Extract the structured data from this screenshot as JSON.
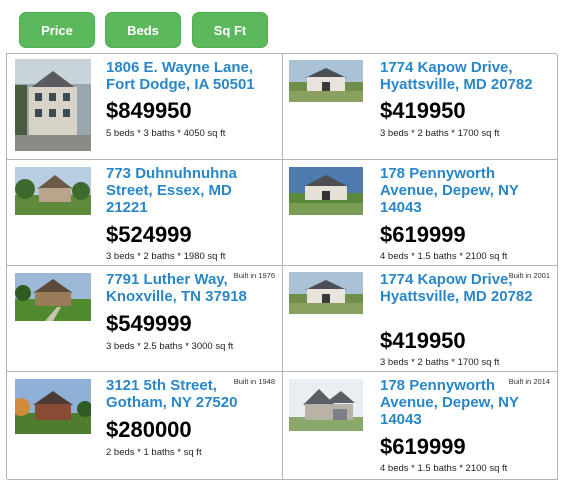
{
  "sort_buttons": [
    "Price",
    "Beds",
    "Sq Ft"
  ],
  "listings": [
    {
      "address": "1806 E. Wayne Lane, Fort Dodge, IA 50501",
      "price": "$849950",
      "details": "5 beds * 3 baths * 4050 sq ft",
      "built": ""
    },
    {
      "address": "1774 Kapow Drive, Hyattsville, MD 20782",
      "price": "$419950",
      "details": "3 beds * 2 baths * 1700 sq ft",
      "built": ""
    },
    {
      "address": "773 Duhnuhnuhna Street, Essex, MD 21221",
      "price": "$524999",
      "details": "3 beds * 2 baths * 1980 sq ft",
      "built": ""
    },
    {
      "address": "178 Pennyworth Avenue, Depew, NY 14043",
      "price": "$619999",
      "details": "4 beds * 1.5 baths * 2100 sq ft",
      "built": ""
    },
    {
      "address": "7791 Luther Way, Knoxville, TN 37918",
      "price": "$549999",
      "details": "3 beds * 2.5 baths * 3000 sq ft",
      "built": "Built in 1976"
    },
    {
      "address": "1774 Kapow Drive, Hyattsville, MD 20782",
      "price": "$419950",
      "details": "3 beds * 2 baths * 1700 sq ft",
      "built": "Built in 2001"
    },
    {
      "address": "3121 5th Street, Gotham, NY 27520",
      "price": "$280000",
      "details": "2 beds * 1 baths * sq ft",
      "built": "Built in 1948"
    },
    {
      "address": "178 Pennyworth Avenue, Depew, NY 14043",
      "price": "$619999",
      "details": "4 beds * 1.5 baths * 2100 sq ft",
      "built": "Built in 2014"
    }
  ],
  "colors": {
    "button": "#5cb85c",
    "link": "#2a87c7",
    "border": "#b4b4b4"
  }
}
